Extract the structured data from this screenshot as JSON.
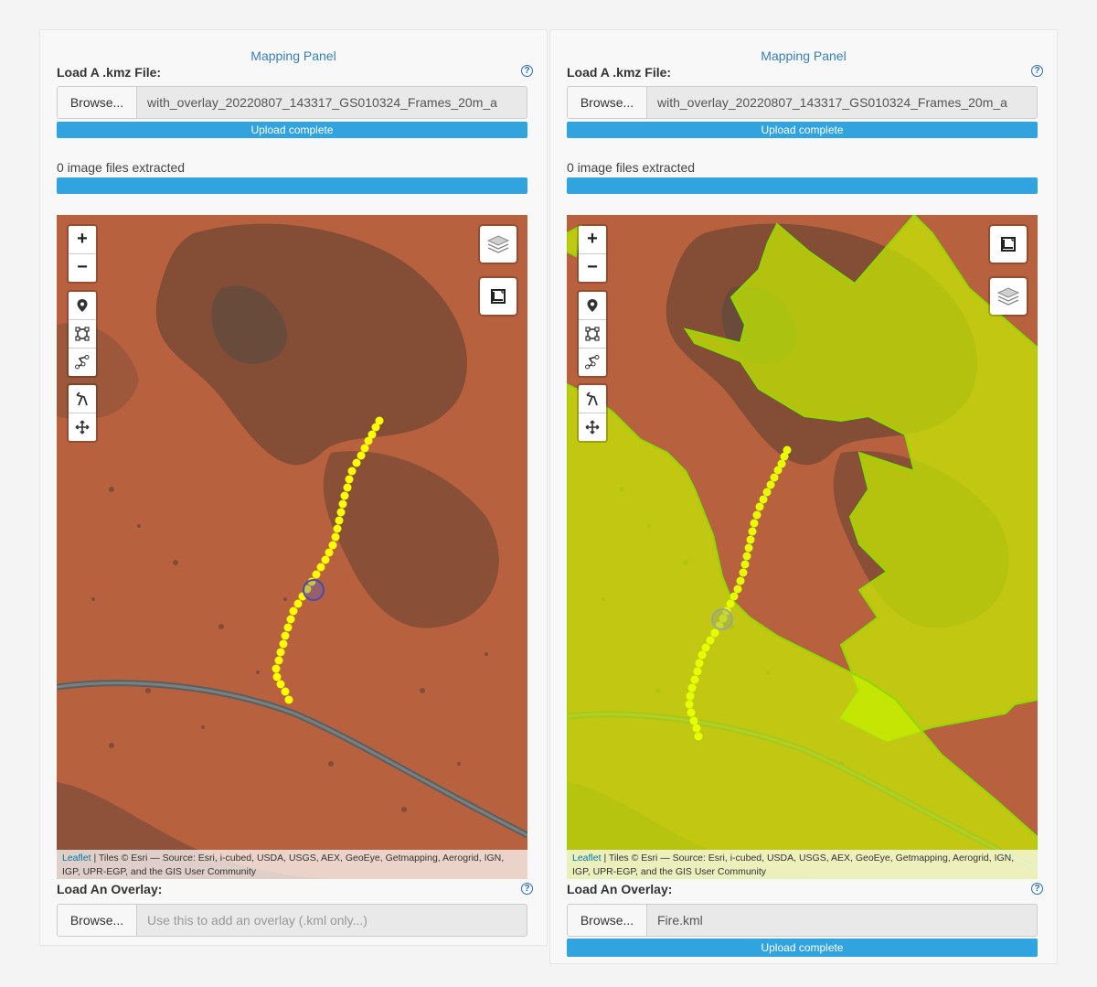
{
  "panels": [
    {
      "id": "left",
      "title": "Mapping Panel",
      "kmz_label": "Load A .kmz File:",
      "browse_label": "Browse...",
      "kmz_file_name": "with_overlay_20220807_143317_GS010324_Frames_20m_a",
      "kmz_upload_status": "Upload complete",
      "extract_text": "0 image files extracted",
      "overlay_label": "Load An Overlay:",
      "overlay_file_name": "",
      "overlay_placeholder": "Use this to add an overlay (.kml only...)",
      "overlay_upload_status": "",
      "fire_overlay_visible": false,
      "top_corner_icon": "layers-icon",
      "bottom_corner_icon": "fullscreen-icon"
    },
    {
      "id": "right",
      "title": "Mapping Panel",
      "kmz_label": "Load A .kmz File:",
      "browse_label": "Browse...",
      "kmz_file_name": "with_overlay_20220807_143317_GS010324_Frames_20m_a",
      "kmz_upload_status": "Upload complete",
      "extract_text": "0 image files extracted",
      "overlay_label": "Load An Overlay:",
      "overlay_file_name": "Fire.kml",
      "overlay_placeholder": "",
      "overlay_upload_status": "Upload complete",
      "fire_overlay_visible": true,
      "top_corner_icon": "fullscreen-icon",
      "bottom_corner_icon": "layers-icon"
    }
  ],
  "map": {
    "zoom_in": "+",
    "zoom_out": "−",
    "attribution_link": "Leaflet",
    "attribution_text": " | Tiles © Esri — Source: Esri, i-cubed, USDA, USGS, AEX, GeoEye, Getmapping, Aerogrid, IGN, IGP, UPR-EGP, and the GIS User Community",
    "tool_icons": [
      "marker-icon",
      "rectangle-icon",
      "polyline-icon",
      "cut-icon",
      "move-icon"
    ]
  },
  "colors": {
    "accent": "#31a4e0",
    "title_blue": "#3a7fb6",
    "terrain": "#b8613e",
    "track_point": "#ffff00",
    "fire_fill": "#c6f000",
    "fire_stroke": "#8ed900"
  }
}
